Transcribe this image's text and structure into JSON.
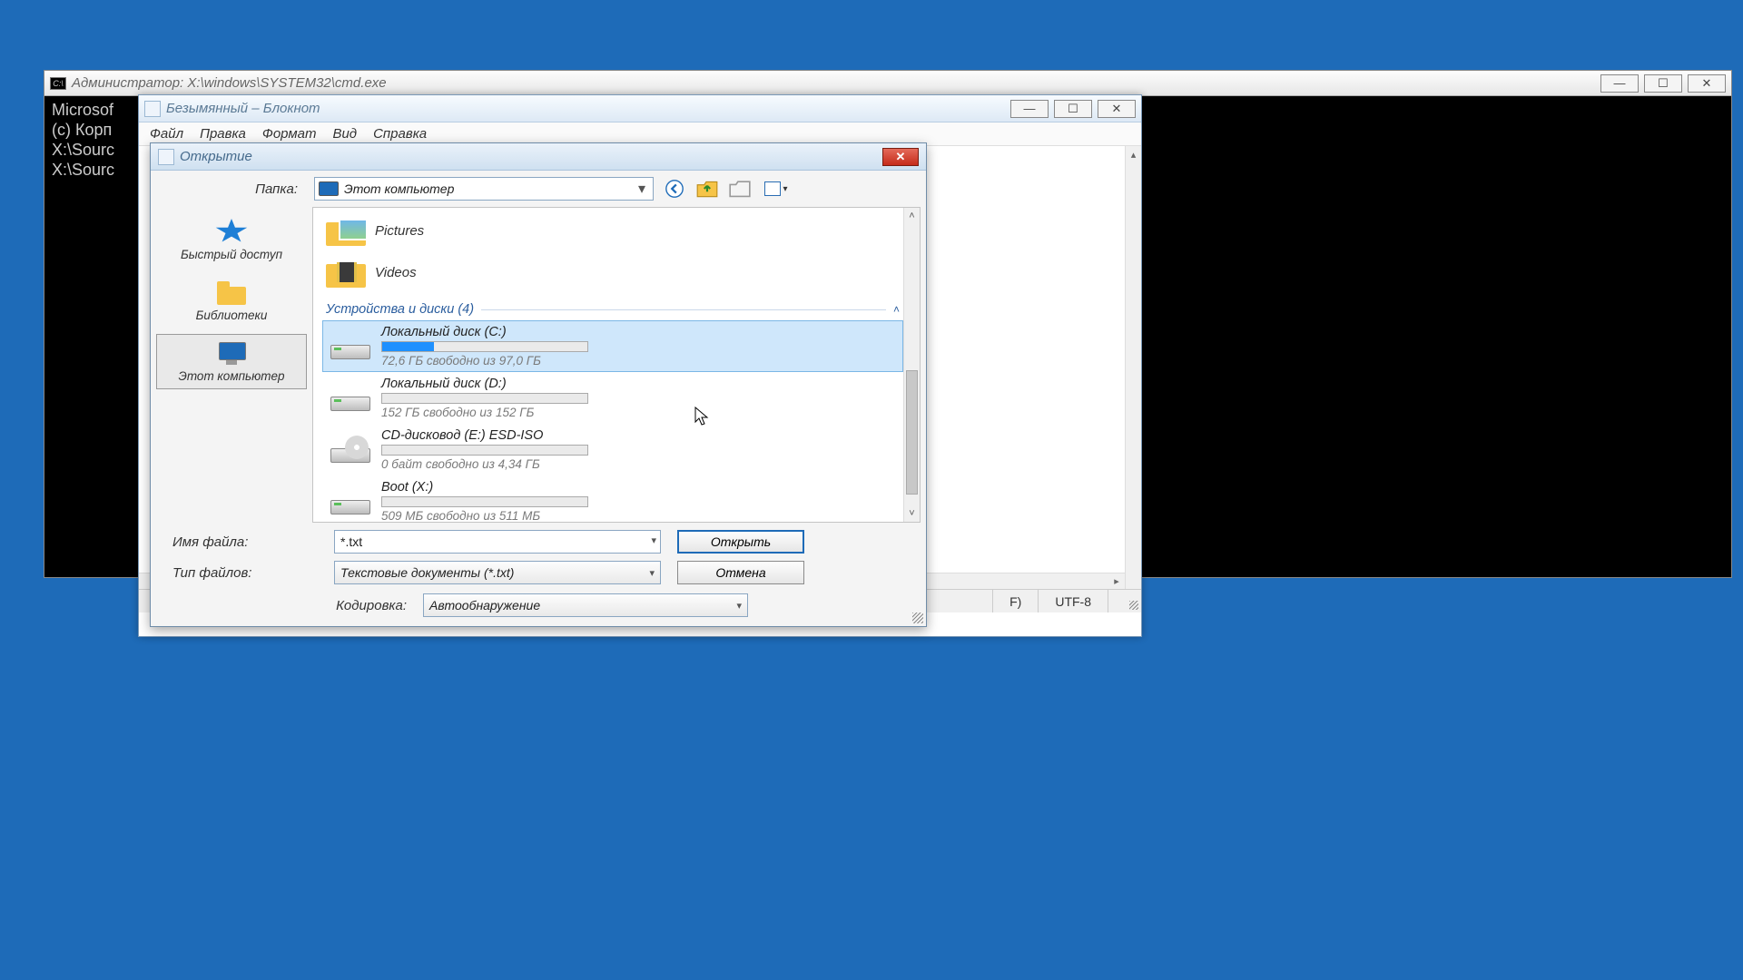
{
  "cmd": {
    "title": "Администратор: X:\\windows\\SYSTEM32\\cmd.exe",
    "lines": [
      "Microsof",
      "(c) Корп",
      "",
      "X:\\Sourc",
      "",
      "X:\\Sourc"
    ]
  },
  "notepad": {
    "title": "Безымянный – Блокнот",
    "menu": {
      "file": "Файл",
      "edit": "Правка",
      "format": "Формат",
      "view": "Вид",
      "help": "Справка"
    },
    "status": {
      "eol_partial": "F)",
      "encoding": "UTF-8"
    }
  },
  "openDialog": {
    "title": "Открытие",
    "lookInLabel": "Папка:",
    "lookInValue": "Этот компьютер",
    "places": {
      "quick": "Быстрый доступ",
      "libraries": "Библиотеки",
      "thisPC": "Этот компьютер"
    },
    "folders": {
      "pictures": "Pictures",
      "videos": "Videos"
    },
    "group": "Устройства и диски (4)",
    "drives": [
      {
        "name": "Локальный диск (C:)",
        "free": "72,6 ГБ свободно из 97,0 ГБ",
        "fillPct": 25,
        "type": "hdd",
        "selected": true
      },
      {
        "name": "Локальный диск (D:)",
        "free": "152 ГБ свободно из 152 ГБ",
        "fillPct": 0,
        "type": "hdd",
        "selected": false
      },
      {
        "name": "CD-дисковод (E:) ESD-ISO",
        "free": "0 байт свободно из 4,34 ГБ",
        "fillPct": 0,
        "type": "cd",
        "selected": false
      },
      {
        "name": "Boot (X:)",
        "free": "509 МБ свободно из 511 МБ",
        "fillPct": 0,
        "type": "hdd",
        "selected": false
      }
    ],
    "fields": {
      "fileNameLabel": "Имя файла:",
      "fileNameValue": "*.txt",
      "fileTypeLabel": "Тип файлов:",
      "fileTypeValue": "Текстовые документы (*.txt)",
      "encodingLabel": "Кодировка:",
      "encodingValue": "Автообнаружение",
      "openBtn": "Открыть",
      "cancelBtn": "Отмена"
    }
  }
}
